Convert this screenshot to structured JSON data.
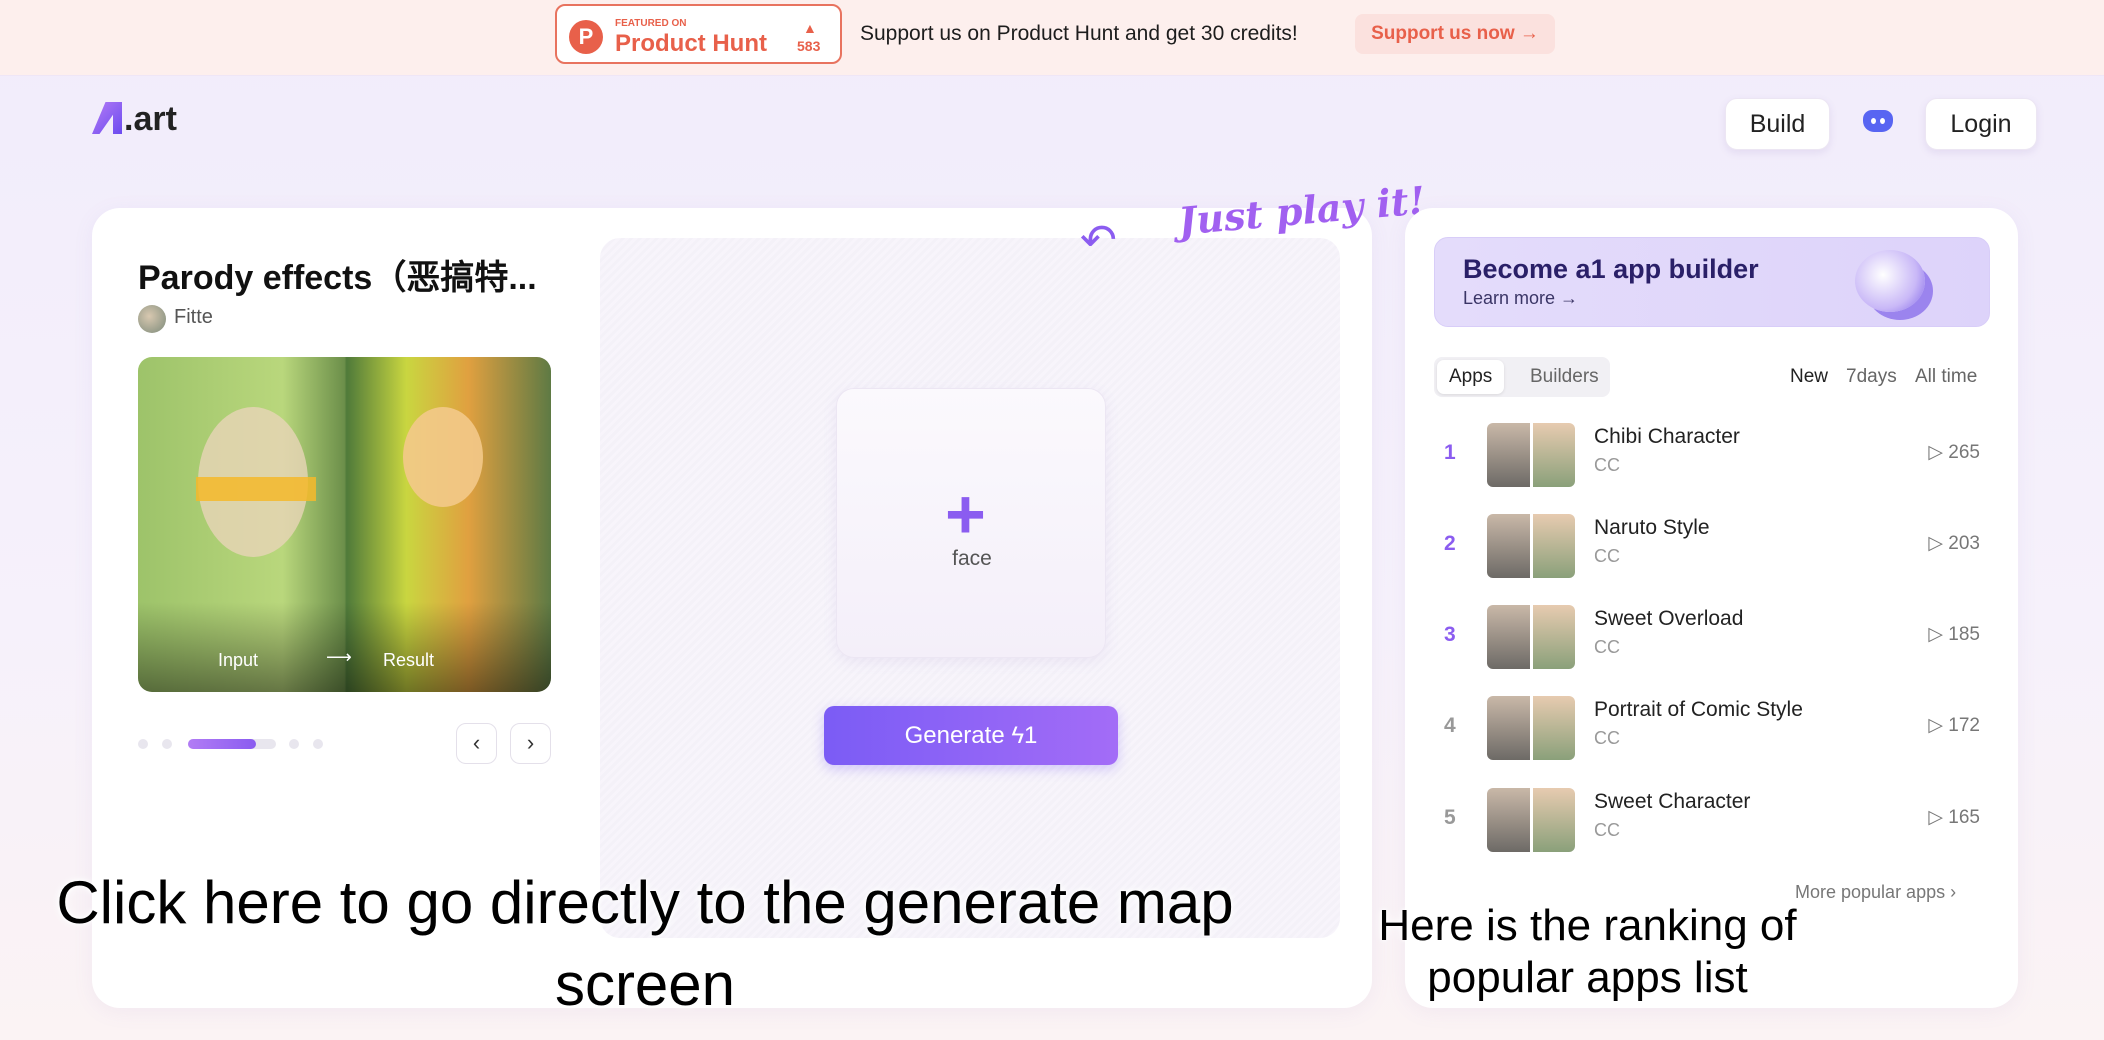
{
  "topbar": {
    "ph_featured": "FEATURED ON",
    "ph_name": "Product Hunt",
    "ph_votes": "583",
    "message": "Support us on Product Hunt and get 30 credits!",
    "support_button": "Support us now →"
  },
  "header": {
    "logo": ".art",
    "build": "Build",
    "login": "Login"
  },
  "app": {
    "title": "Parody effects（恶搞特...",
    "author": "Fitte",
    "input_label": "Input",
    "arrow": "⟶",
    "result_label": "Result",
    "carousel_active_index": 3,
    "upload_label": "face",
    "generate": "Generate ϟ1",
    "hint": "Just play it!"
  },
  "sidebar": {
    "banner_title": "Become a1 app builder",
    "banner_link": "Learn more →",
    "tabs": [
      "Apps",
      "Builders"
    ],
    "filters": [
      "New",
      "7days",
      "All time"
    ],
    "apps": [
      {
        "rank": "1",
        "name": "Chibi Character",
        "author": "CC",
        "plays": "265"
      },
      {
        "rank": "2",
        "name": "Naruto Style",
        "author": "CC",
        "plays": "203"
      },
      {
        "rank": "3",
        "name": "Sweet Overload",
        "author": "CC",
        "plays": "185"
      },
      {
        "rank": "4",
        "name": "Portrait of Comic Style",
        "author": "CC",
        "plays": "172"
      },
      {
        "rank": "5",
        "name": "Sweet Character",
        "author": "CC",
        "plays": "165"
      }
    ],
    "more": "More popular apps ›"
  },
  "annotations": {
    "left": "Click here to go directly to the generate map screen",
    "right": "Here is the ranking of popular apps list"
  },
  "colors": {
    "accent": "#8b5cf0",
    "producthunt": "#e8604a",
    "discord": "#5865f2"
  }
}
